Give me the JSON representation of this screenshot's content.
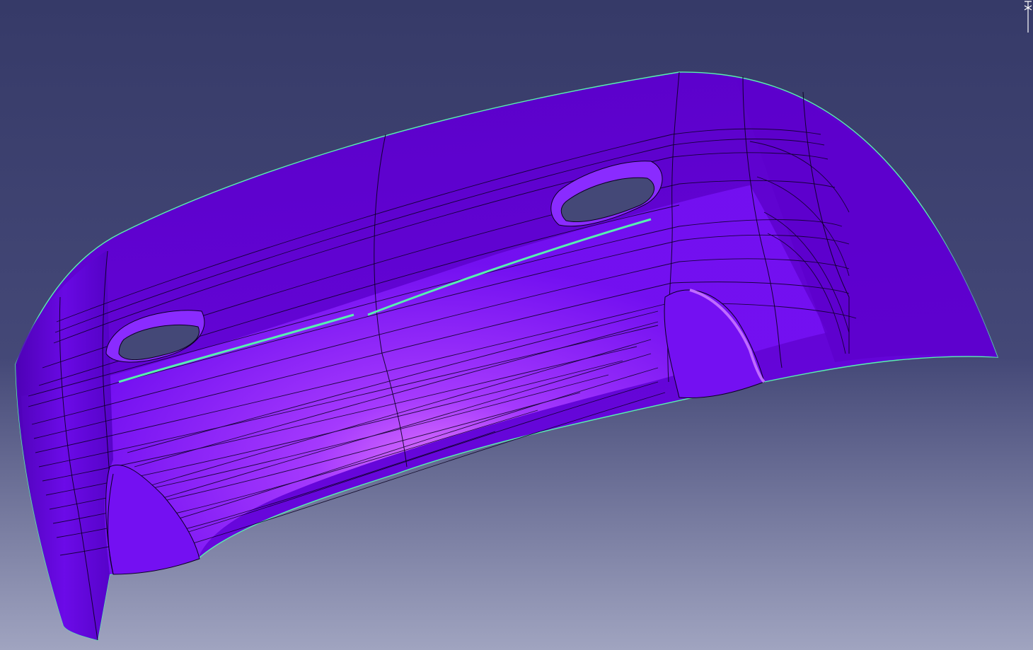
{
  "viewport": {
    "background": {
      "top": "#363a68",
      "mid": "#444877",
      "bottom": "#a0a4c0"
    },
    "part": {
      "shade_dark": "#4a00b0",
      "shade_mid": "#6a0ae6",
      "shade_light": "#8f2bff",
      "highlight": "#e67cff",
      "edge_color": "#0a0020",
      "boundary_color": "#58f0b0"
    },
    "compass": {
      "icon": "compass-icon",
      "color": "#ffffff"
    }
  }
}
